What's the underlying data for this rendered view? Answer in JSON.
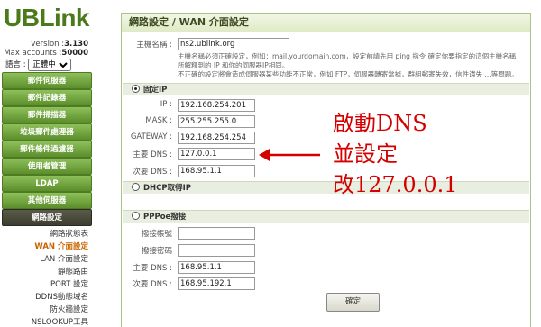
{
  "sidebar": {
    "logo": "UBLink",
    "version_label": "version :",
    "version_value": "3.130",
    "accounts_label": "Max accounts :",
    "accounts_value": "50000",
    "language_label": "語言 :",
    "language_value": "正體中文",
    "nav": [
      {
        "label": "郵件伺服器"
      },
      {
        "label": "郵件記錄器"
      },
      {
        "label": "郵件掃描器"
      },
      {
        "label": "垃圾郵件處理器"
      },
      {
        "label": "郵件條件過濾器"
      },
      {
        "label": "使用者管理"
      },
      {
        "label": "LDAP"
      },
      {
        "label": "其他伺服器"
      },
      {
        "label": "網路設定"
      }
    ],
    "subnav": [
      {
        "label": "網路狀態表"
      },
      {
        "label": "WAN 介面設定"
      },
      {
        "label": "LAN 介面設定"
      },
      {
        "label": "靜態路由"
      },
      {
        "label": "PORT 設定"
      },
      {
        "label": "DDNS動態域名"
      },
      {
        "label": "防火牆設定"
      },
      {
        "label": "NSLOOKUP工具"
      }
    ]
  },
  "main": {
    "title": "網路設定 / WAN 介面設定",
    "hostname_label": "主機名稱 :",
    "hostname_value": "ns2.ublink.org",
    "hostname_note1": "主機名稱必須正確設定，例如：mail.yourdomain.com，設定前請先用 ping 指令 確定你要指定的這個主機名稱",
    "hostname_note2": "所解釋到的 IP 和你的伺服器IP相同。",
    "hostname_note3": "不正確的設定將會造成伺服器某些功能不正常，例如 FTP，伺服器轉寄當掉，群組郵寄失效，信件遺失 ...等問題。",
    "fixed_ip": {
      "label": "固定IP",
      "ip_label": "IP :",
      "ip_value": "192.168.254.201",
      "mask_label": "MASK :",
      "mask_value": "255.255.255.0",
      "gateway_label": "GATEWAY :",
      "gateway_value": "192.168.254.254",
      "dns1_label": "主要 DNS :",
      "dns1_value": "127.0.0.1",
      "dns2_label": "次要 DNS :",
      "dns2_value": "168.95.1.1"
    },
    "dhcp": {
      "label": "DHCP取得IP"
    },
    "pppoe": {
      "label": "PPPoe撥接",
      "account_label": "撥接帳號",
      "account_value": "",
      "password_label": "撥接密碼",
      "password_value": "",
      "dns1_label": "主要 DNS :",
      "dns1_value": "168.95.1.1",
      "dns2_label": "次要 DNS :",
      "dns2_value": "168.95.192.1"
    },
    "ok_label": "確定"
  },
  "annotation": {
    "line1": "啟動DNS",
    "line2": "並設定",
    "line3": "改127.0.0.1",
    "color": "#d40000"
  }
}
